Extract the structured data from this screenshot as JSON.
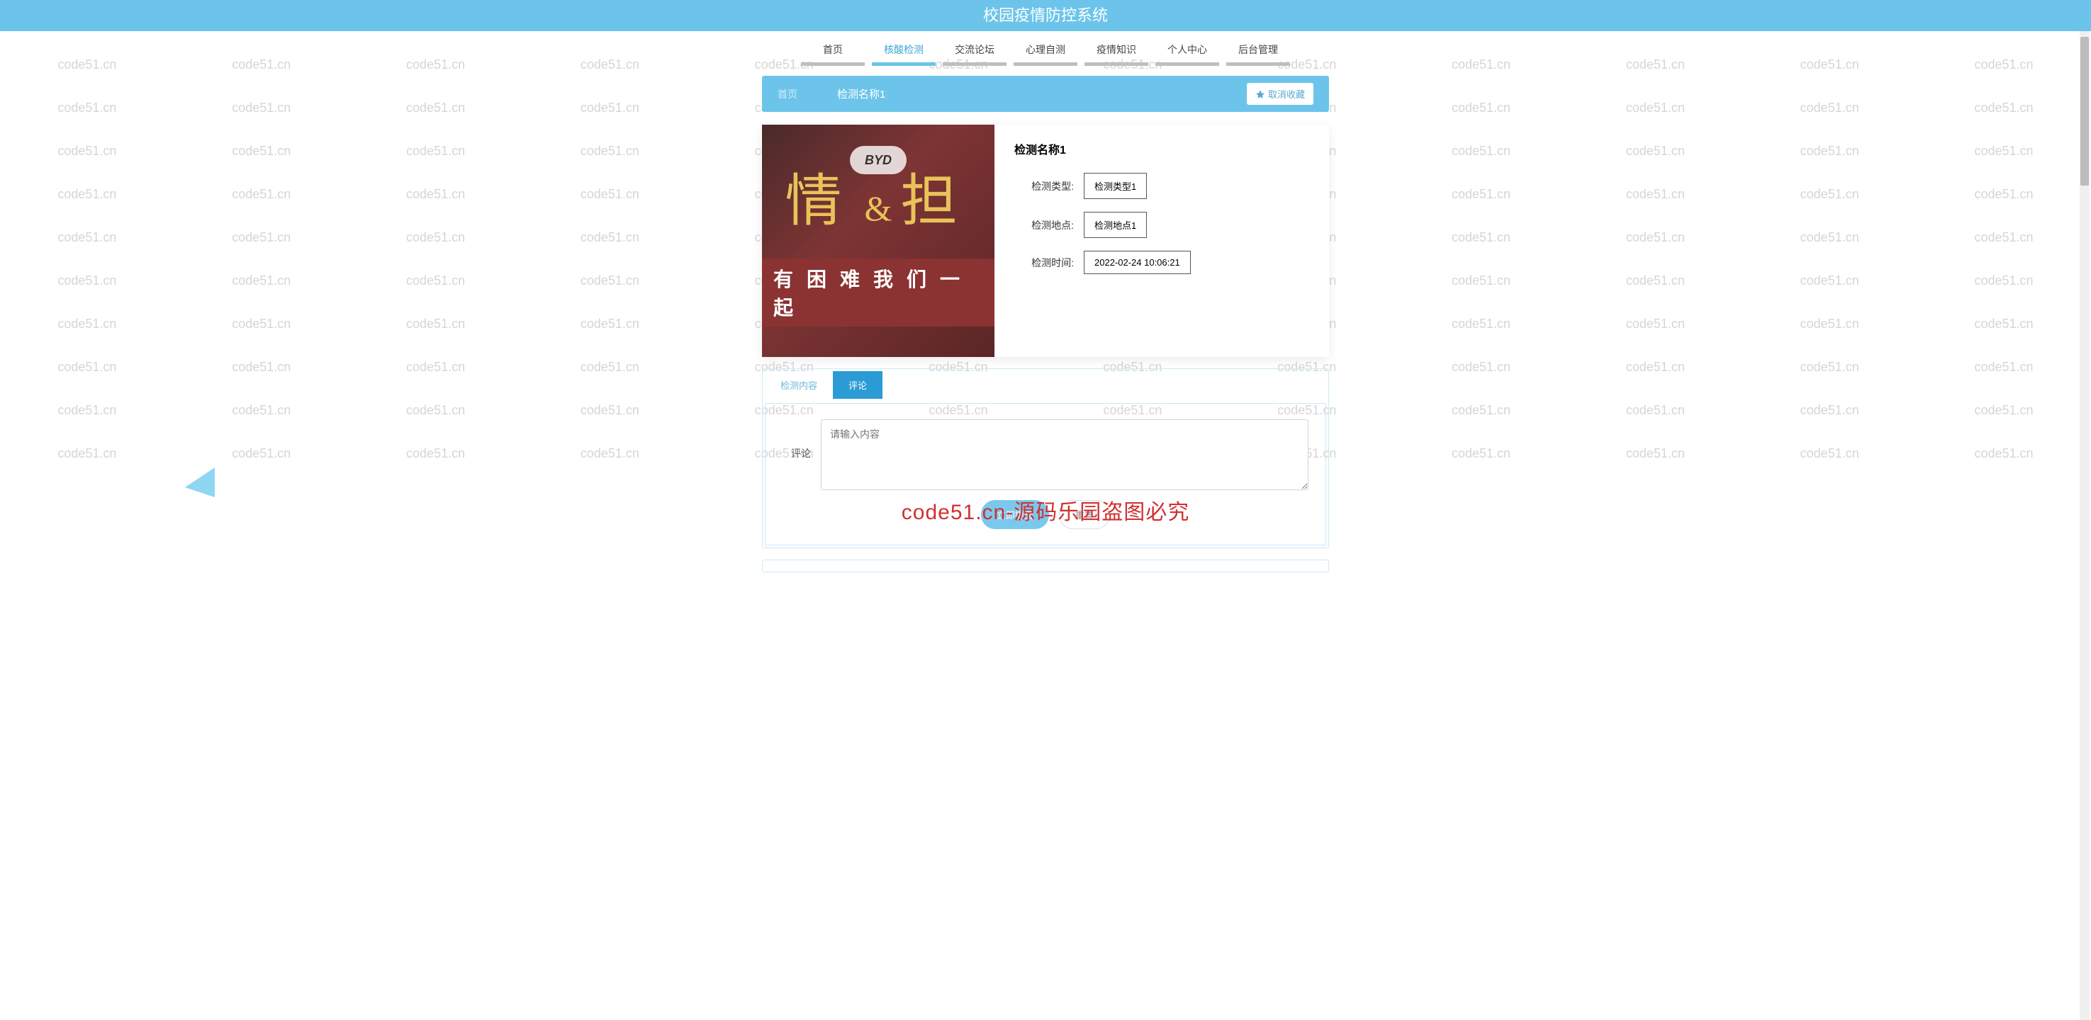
{
  "colors": {
    "primary": "#6cc4ea",
    "accent": "#2b9bd5"
  },
  "watermark_text": "code51.cn",
  "watermark_banner": "code51.cn-源码乐园盗图必究",
  "header": {
    "title": "校园疫情防控系统"
  },
  "nav": {
    "items": [
      {
        "label": "首页"
      },
      {
        "label": "核酸检测",
        "active": true
      },
      {
        "label": "交流论坛"
      },
      {
        "label": "心理自测"
      },
      {
        "label": "疫情知识"
      },
      {
        "label": "个人中心"
      },
      {
        "label": "后台管理"
      }
    ]
  },
  "breadcrumb": {
    "home": "首页",
    "title": "检测名称1",
    "cancel_fav_label": "取消收藏"
  },
  "detail": {
    "title": "检测名称1",
    "image_text_line1_a": "情",
    "image_text_amp": "&",
    "image_text_line1_b": "担",
    "image_badge": "BYD",
    "image_text_line2": "有 困 难 我 们 一 起",
    "fields": [
      {
        "label": "检测类型:",
        "value": "检测类型1"
      },
      {
        "label": "检测地点:",
        "value": "检测地点1"
      },
      {
        "label": "检测时间:",
        "value": "2022-02-24 10:06:21"
      }
    ]
  },
  "tabs": {
    "items": [
      {
        "label": "检测内容"
      },
      {
        "label": "评论",
        "active": true
      }
    ]
  },
  "comment_form": {
    "label": "评论",
    "placeholder": "请输入内容",
    "submit_label": "立即提交",
    "reset_label": "重置"
  }
}
